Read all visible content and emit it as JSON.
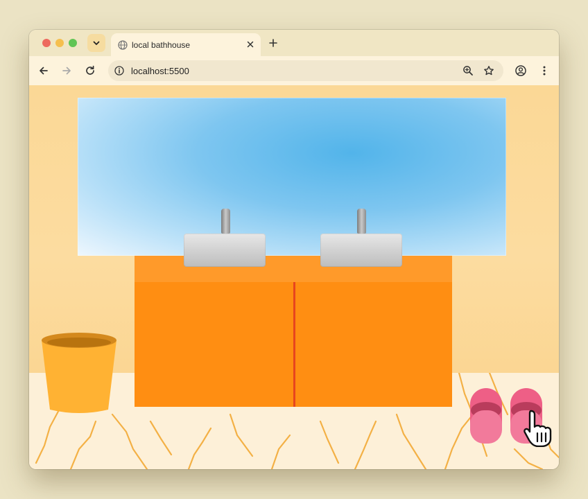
{
  "browser": {
    "tab_title": "local bathhouse",
    "url": "localhost:5500"
  },
  "icons": {
    "tab_menu": "chevron-down-icon",
    "favicon": "globe-icon",
    "close": "close-icon",
    "new_tab": "plus-icon",
    "back": "arrow-left-icon",
    "forward": "arrow-right-icon",
    "reload": "reload-icon",
    "site_info": "info-icon",
    "zoom": "zoom-icon",
    "bookmark": "star-icon",
    "profile": "profile-icon",
    "menu": "kebab-menu-icon",
    "cursor": "hand-pointer-icon"
  },
  "colors": {
    "wall": "#fbd896",
    "mirror": "#52b4ea",
    "cabinet": "#ff8e12",
    "cabinet_seam": "#e7451e",
    "slippers": "#ee5f86",
    "bucket": "#ffb233"
  }
}
